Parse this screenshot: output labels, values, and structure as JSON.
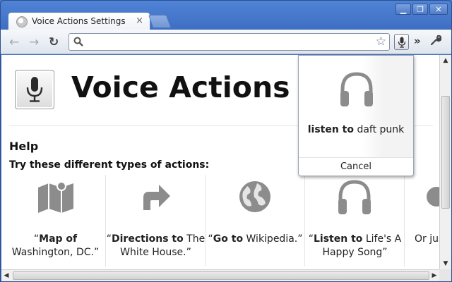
{
  "browser": {
    "tab_title": "Voice Actions Settings",
    "tab_close": "×",
    "window_buttons": {
      "minimize": "▁",
      "maximize": "❐",
      "close": "✕"
    },
    "nav": {
      "back": "←",
      "forward": "→",
      "reload": "↻",
      "chevron": "»",
      "wrench": "🔧",
      "star": "☆"
    },
    "omnibox_value": ""
  },
  "page": {
    "title": "Voice Actions Se",
    "help_heading": "Help",
    "subheading": "Try these different types of actions:",
    "cards": [
      {
        "icon": "map-icon",
        "bold": "Map of",
        "pre": "“",
        "rest": " Washington, DC.”"
      },
      {
        "icon": "directions-icon",
        "bold": "Directions to",
        "pre": "“",
        "rest": " The White House.”"
      },
      {
        "icon": "globe-icon",
        "bold": "Go to",
        "pre": "“",
        "rest": " Wikipedia.”"
      },
      {
        "icon": "headphones-icon",
        "bold": "Listen to",
        "pre": "“",
        "rest": " Life's A Happy Song”"
      },
      {
        "icon": "partial-icon",
        "bold": "",
        "pre": "",
        "rest": "Or jus a"
      }
    ]
  },
  "popup": {
    "query_bold": "listen to",
    "query_rest": " daft punk",
    "cancel": "Cancel"
  },
  "colors": {
    "icon_gray": "#8c8c8c",
    "chrome_blue": "#4f83d6"
  }
}
